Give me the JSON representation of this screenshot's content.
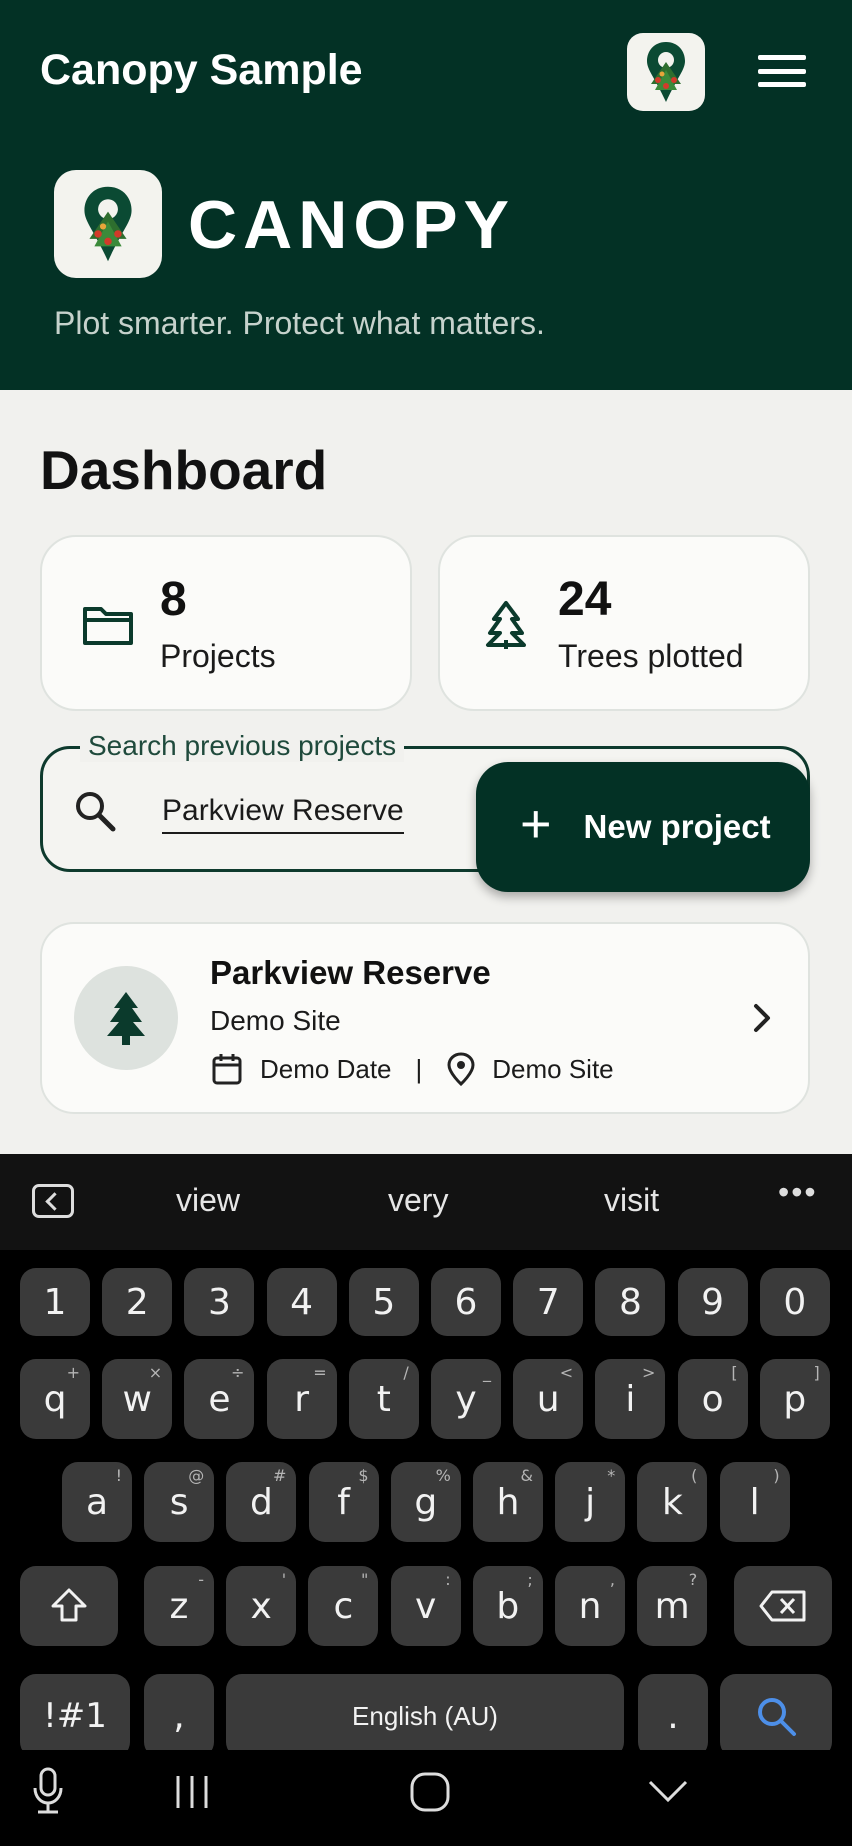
{
  "appbar": {
    "title": "Canopy Sample"
  },
  "hero": {
    "brand": "CANOPY",
    "tagline": "Plot smarter. Protect what matters."
  },
  "dashboard": {
    "title": "Dashboard",
    "stats": [
      {
        "value": "8",
        "label": "Projects",
        "icon": "folder-icon"
      },
      {
        "value": "24",
        "label": "Trees plotted",
        "icon": "tree-icon"
      }
    ]
  },
  "search": {
    "label": "Search previous projects",
    "value": "Parkview Reserve"
  },
  "fab": {
    "label": "New project"
  },
  "projects": [
    {
      "name": "Parkview Reserve",
      "subtitle": "Demo Site",
      "date": "Demo Date",
      "location": "Demo Site"
    }
  ],
  "keyboard": {
    "suggestions": [
      "view",
      "very",
      "visit"
    ],
    "number_row": [
      "1",
      "2",
      "3",
      "4",
      "5",
      "6",
      "7",
      "8",
      "9",
      "0"
    ],
    "row1": [
      {
        "k": "q",
        "s": "+"
      },
      {
        "k": "w",
        "s": "×"
      },
      {
        "k": "e",
        "s": "÷"
      },
      {
        "k": "r",
        "s": "="
      },
      {
        "k": "t",
        "s": "/"
      },
      {
        "k": "y",
        "s": "_"
      },
      {
        "k": "u",
        "s": "<"
      },
      {
        "k": "i",
        "s": ">"
      },
      {
        "k": "o",
        "s": "["
      },
      {
        "k": "p",
        "s": "]"
      }
    ],
    "row2": [
      {
        "k": "a",
        "s": "!"
      },
      {
        "k": "s",
        "s": "@"
      },
      {
        "k": "d",
        "s": "#"
      },
      {
        "k": "f",
        "s": "$"
      },
      {
        "k": "g",
        "s": "%"
      },
      {
        "k": "h",
        "s": "&"
      },
      {
        "k": "j",
        "s": "*"
      },
      {
        "k": "k",
        "s": "("
      },
      {
        "k": "l",
        "s": ")"
      }
    ],
    "row3": [
      {
        "k": "z",
        "s": "-"
      },
      {
        "k": "x",
        "s": "'"
      },
      {
        "k": "c",
        "s": "\""
      },
      {
        "k": "v",
        "s": ":"
      },
      {
        "k": "b",
        "s": ";"
      },
      {
        "k": "n",
        "s": ","
      },
      {
        "k": "m",
        "s": "?"
      }
    ],
    "symbols_key": "!#1",
    "comma_key": ",",
    "space_label": "English (AU)",
    "period_key": "."
  },
  "colors": {
    "primary": "#033125",
    "accent_blue": "#4d8fe8"
  }
}
